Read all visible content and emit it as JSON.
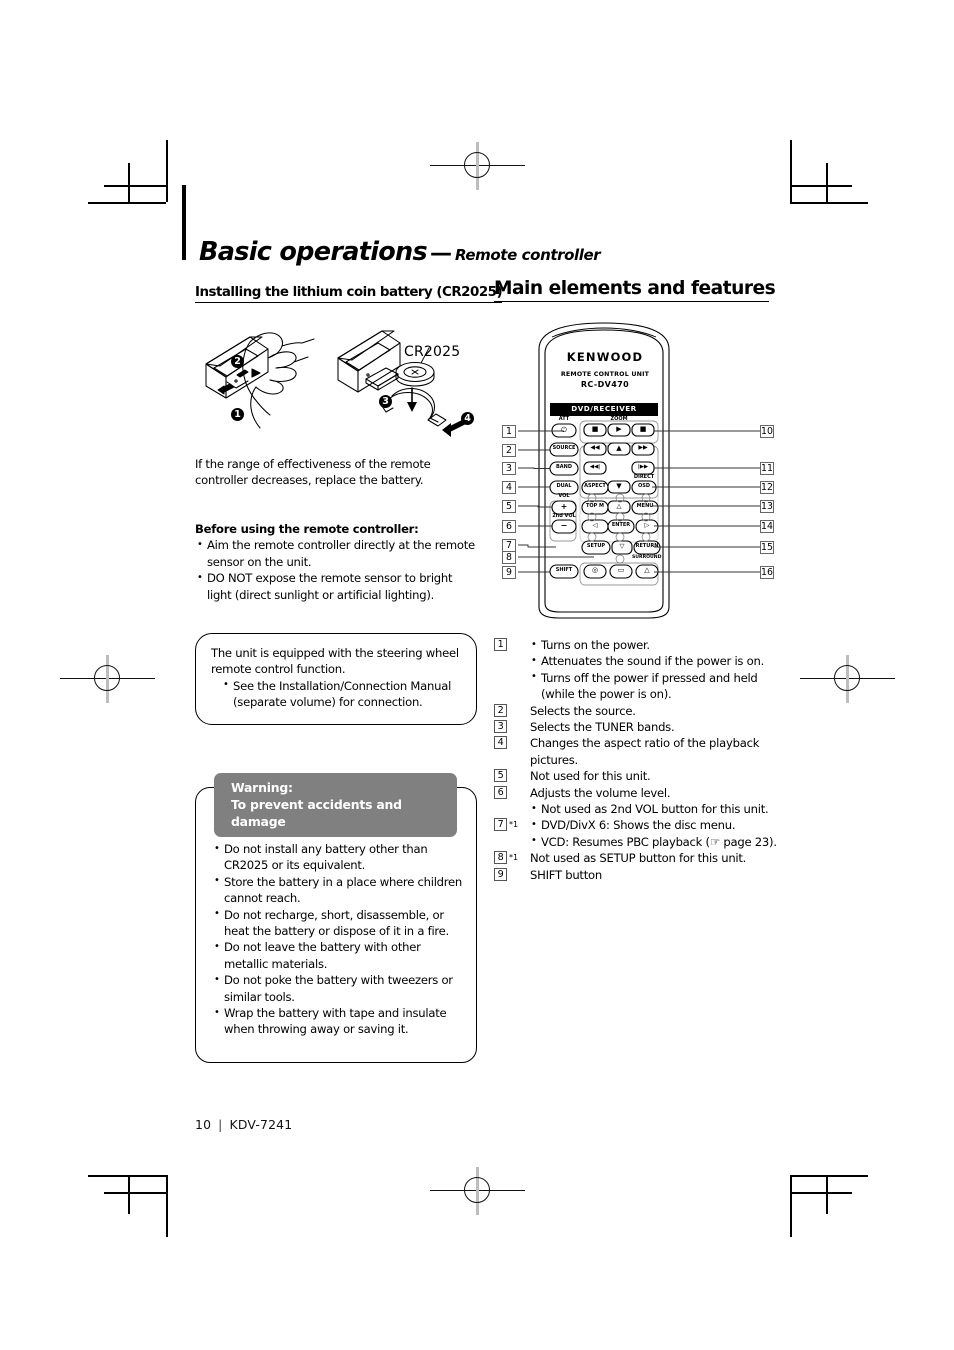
{
  "page": {
    "number": "10",
    "separator": "|",
    "model": "KDV-7241"
  },
  "header": {
    "chapter": "Basic operations",
    "dash": "—",
    "subtitle": "Remote controller"
  },
  "sections": {
    "battery": {
      "heading": "Installing the lithium coin battery (CR2025)",
      "figure": {
        "battery_label": "CR2025",
        "step_markers": [
          "1",
          "2",
          "3",
          "4"
        ]
      },
      "intro": "If the range of effectiveness of the remote controller decreases, replace the battery.",
      "before_using_heading": "Before using the remote controller:",
      "before_using_items": [
        "Aim the remote controller directly at the remote sensor on the unit.",
        "DO NOT expose the remote sensor to bright light (direct sunlight or artificial lighting)."
      ],
      "note_box": {
        "text": "The unit is equipped with the steering wheel remote control function.",
        "items": [
          "See the Installation/Connection Manual (separate volume) for connection."
        ]
      },
      "warning": {
        "title_line1": "Warning:",
        "title_line2": "To prevent accidents and damage",
        "items": [
          "Do not install any battery other than CR2025 or its equivalent.",
          "Store the battery in a place where children cannot reach.",
          "Do not recharge, short, disassemble, or heat the battery or dispose of it in a fire.",
          "Do not leave the battery with other metallic materials.",
          "Do not poke the battery with tweezers or similar tools.",
          "Wrap the battery with tape and insulate when throwing away or saving it."
        ],
        "header_color": "#808080"
      }
    },
    "main_elements": {
      "heading": "Main elements and features",
      "remote": {
        "brand": "KENWOOD",
        "unit_line1": "REMOTE CONTROL UNIT",
        "unit_line2": "RC-DV470",
        "banner": "DVD/RECEIVER",
        "buttons": {
          "att_label": "ATT",
          "att": "⏻",
          "zoom_label": "ZOOM",
          "stop_left": "■",
          "play": "▶",
          "stop_right": "■",
          "source": "SOURCE",
          "rew": "◀◀",
          "up": "▲",
          "ff": "▶▶",
          "band": "BAND",
          "prev": "◀◀|",
          "next": "|▶▶",
          "dual": "DUAL",
          "aspect": "ASPECT",
          "down": "▼",
          "direct_label": "DIRECT",
          "osd": "OSD",
          "vol_label": "VOL",
          "vol_plus": "+",
          "topm": "TOP M",
          "arrow_up": "△",
          "menu": "MENU",
          "vol2_label": "2nd VOL",
          "vol_minus": "−",
          "arrow_left": "◁",
          "enter": "ENTER",
          "arrow_right": "▷",
          "setup": "SETUP",
          "arrow_down": "▽",
          "return": "RETURN",
          "surround_label": "SURROUND",
          "shift": "SHIFT",
          "disc": "◎",
          "folder": "▭",
          "audio": "△"
        },
        "callouts_left": [
          "1",
          "2",
          "3",
          "4",
          "5",
          "6",
          "7",
          "8",
          "9"
        ],
        "callouts_right": [
          "10",
          "11",
          "12",
          "13",
          "14",
          "15",
          "16"
        ]
      },
      "features": [
        {
          "num": "1",
          "star": "",
          "text": "",
          "subitems": [
            "Turns on the power.",
            "Attenuates the sound if the power is on.",
            "Turns off the power if pressed and held (while the power is on)."
          ]
        },
        {
          "num": "2",
          "star": "",
          "text": "Selects the source.",
          "subitems": []
        },
        {
          "num": "3",
          "star": "",
          "text": "Selects the TUNER bands.",
          "subitems": []
        },
        {
          "num": "4",
          "star": "",
          "text": "Changes the aspect ratio of the playback pictures.",
          "subitems": []
        },
        {
          "num": "5",
          "star": "",
          "text": "Not used for this unit.",
          "subitems": []
        },
        {
          "num": "6",
          "star": "",
          "text": "Adjusts the volume level.",
          "subitems": [
            "Not used as 2nd VOL button for this unit."
          ]
        },
        {
          "num": "7",
          "star": "*1",
          "text": "",
          "subitems": [
            "DVD/DivX 6: Shows the disc menu.",
            "VCD: Resumes PBC playback (☞ page 23)."
          ]
        },
        {
          "num": "8",
          "star": "*1",
          "text": "Not used as SETUP button for this unit.",
          "subitems": []
        },
        {
          "num": "9",
          "star": "",
          "text": "SHIFT button",
          "subitems": []
        }
      ]
    }
  }
}
